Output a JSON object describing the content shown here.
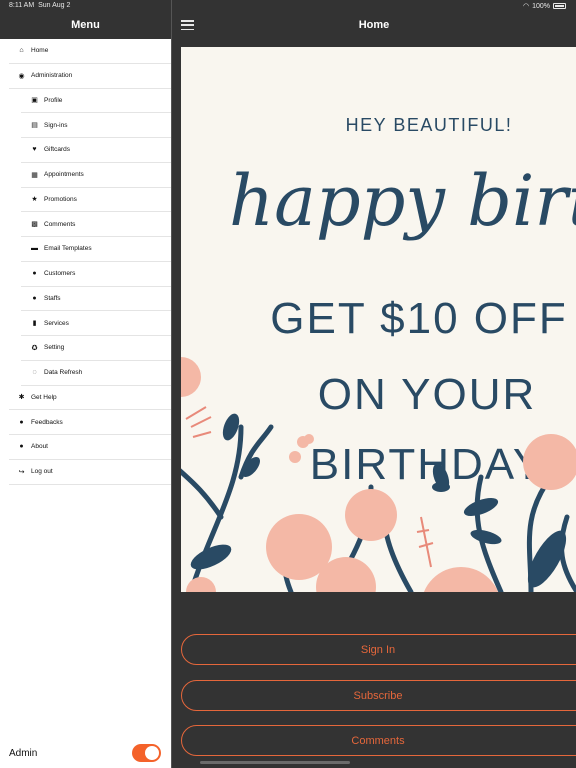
{
  "status_bar": {
    "time": "8:11 AM",
    "date": "Sun Aug 2",
    "battery": "100%"
  },
  "sidebar": {
    "title": "Menu",
    "items": [
      {
        "label": "Home",
        "icon": "home-icon",
        "glyph": "⌂",
        "level": 0
      },
      {
        "label": "Administration",
        "icon": "admin-icon",
        "glyph": "◉",
        "level": 0
      },
      {
        "label": "Profile",
        "icon": "book-icon",
        "glyph": "▣",
        "level": 1
      },
      {
        "label": "Sign-ins",
        "icon": "signin-icon",
        "glyph": "▤",
        "level": 1
      },
      {
        "label": "Giftcards",
        "icon": "heart-icon",
        "glyph": "♥",
        "level": 1
      },
      {
        "label": "Appointments",
        "icon": "calendar-icon",
        "glyph": "▦",
        "level": 1
      },
      {
        "label": "Promotions",
        "icon": "star-icon",
        "glyph": "★",
        "level": 1
      },
      {
        "label": "Comments",
        "icon": "comments-icon",
        "glyph": "▩",
        "level": 1
      },
      {
        "label": "Email Templates",
        "icon": "folder-icon",
        "glyph": "▬",
        "level": 1
      },
      {
        "label": "Customers",
        "icon": "customers-icon",
        "glyph": "●",
        "level": 1
      },
      {
        "label": "Staffs",
        "icon": "staffs-icon",
        "glyph": "●",
        "level": 1
      },
      {
        "label": "Services",
        "icon": "services-icon",
        "glyph": "▮",
        "level": 1
      },
      {
        "label": "Setting",
        "icon": "gear-icon",
        "glyph": "✪",
        "level": 1
      },
      {
        "label": "Data Refresh",
        "icon": "refresh-icon",
        "glyph": "◌",
        "level": 1
      },
      {
        "label": "Get Help",
        "icon": "help-icon",
        "glyph": "✱",
        "level": 0
      },
      {
        "label": "Feedbacks",
        "icon": "feedback-icon",
        "glyph": "●",
        "level": 0
      },
      {
        "label": "About",
        "icon": "info-icon",
        "glyph": "●",
        "level": 0
      },
      {
        "label": "Log out",
        "icon": "logout-icon",
        "glyph": "↪",
        "level": 0
      }
    ],
    "footer": {
      "label": "Admin",
      "toggle_on": true
    }
  },
  "main": {
    "title": "Home",
    "promo": {
      "line1": "HEY BEAUTIFUL!",
      "line2": "happy birthday",
      "line3": "GET $10 OFF",
      "line4": "ON YOUR",
      "line5": "BIRTHDAY"
    },
    "buttons": [
      "Sign In",
      "Subscribe",
      "Comments"
    ]
  },
  "colors": {
    "accent": "#f4622a",
    "button_border": "#e5673b",
    "dark_bg": "#333333",
    "promo_bg": "#f9f6ef",
    "promo_text": "#294a64",
    "flower_pink": "#f4b8a6"
  }
}
